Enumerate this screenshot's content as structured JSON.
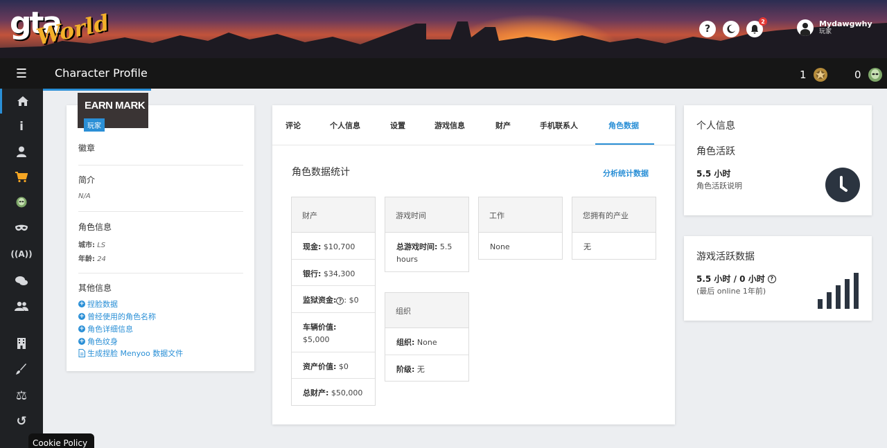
{
  "header": {
    "page_title": "Character Profile",
    "badge_count": "1",
    "alien_count": "0",
    "notif_count": "2",
    "help_glyph": "?",
    "user_name": "Mydawgwhy",
    "user_role": "玩家"
  },
  "sidebar": {
    "items": [
      {
        "icon": "home-icon",
        "glyph": "⌂"
      },
      {
        "icon": "info-icon",
        "glyph": "i"
      },
      {
        "icon": "user-icon",
        "glyph": "●"
      },
      {
        "icon": "cart-icon",
        "glyph": "🛒"
      },
      {
        "icon": "alien-icon",
        "glyph": "☻"
      },
      {
        "icon": "mask-icon",
        "glyph": "◉◉"
      },
      {
        "icon": "broadcast-icon",
        "glyph": "((A))"
      },
      {
        "icon": "chat-icon",
        "glyph": "💬"
      },
      {
        "icon": "users-icon",
        "glyph": "👥"
      },
      {
        "icon": "building-icon",
        "glyph": "▦"
      },
      {
        "icon": "brush-icon",
        "glyph": "✎"
      },
      {
        "icon": "scale-icon",
        "glyph": "⚖"
      },
      {
        "icon": "undo-icon",
        "glyph": "↺"
      }
    ]
  },
  "profile": {
    "name": "EARN MARK",
    "role": "玩家",
    "badges_label": "徽章",
    "bio_label": "简介",
    "bio_value": "N/A",
    "char_info_label": "角色信息",
    "city_label": "城市:",
    "city_value": "LS",
    "age_label": "年龄:",
    "age_value": "24",
    "other_info_label": "其他信息",
    "links": [
      "捏脸数据",
      "曾经使用的角色名称",
      "角色详细信息",
      "角色纹身",
      "生成捏脸 Menyoo 数据文件"
    ]
  },
  "tabs": [
    "评论",
    "个人信息",
    "设置",
    "游戏信息",
    "财产",
    "手机联系人",
    "角色数据"
  ],
  "stats": {
    "title": "角色数据统计",
    "link": "分析统计数据",
    "property": {
      "header": "财产",
      "rows": [
        {
          "label": "现金:",
          "value": "$10,700"
        },
        {
          "label": "银行:",
          "value": "$34,300"
        },
        {
          "label": "监狱资金:",
          "value": "$0",
          "help": "?"
        },
        {
          "label": "车辆价值:",
          "value": "$5,000"
        },
        {
          "label": "资产价值:",
          "value": "$0"
        },
        {
          "label": "总财产:",
          "value": "$50,000"
        }
      ]
    },
    "playtime": {
      "header": "游戏时间",
      "label": "总游戏时间:",
      "value": "5.5 hours"
    },
    "job": {
      "header": "工作",
      "value": "None"
    },
    "owned": {
      "header": "您拥有的产业",
      "value": "无"
    },
    "org": {
      "header": "组织",
      "rows": [
        {
          "label": "组织:",
          "value": "None"
        },
        {
          "label": "阶级:",
          "value": "无"
        }
      ]
    }
  },
  "right": {
    "personal_title": "个人信息",
    "activity_title": "角色活跃",
    "activity_hours": "5.5 小时",
    "activity_desc": "角色活跃说明",
    "game_title": "游戏活跃数据",
    "game_hours": "5.5 小时 / 0 小时",
    "game_help": "?",
    "game_last": "(最后 online 1年前)"
  },
  "cookie": "Cookie Policy",
  "colors": {
    "accent": "#2a8fd6",
    "cart": "#f5a623"
  }
}
